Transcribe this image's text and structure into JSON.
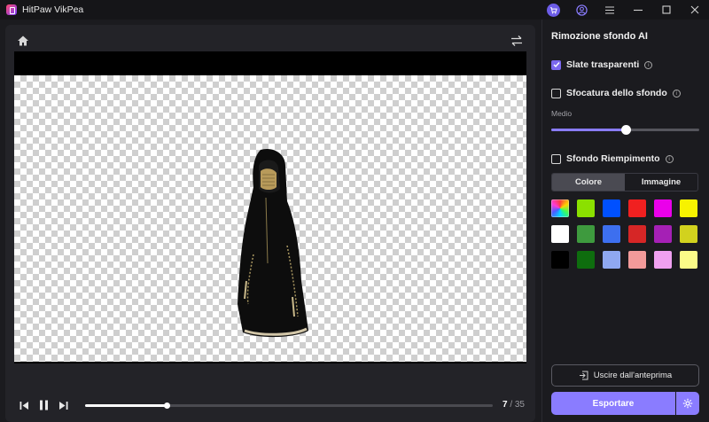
{
  "app": {
    "title": "HitPaw VikPea"
  },
  "player": {
    "current_frame": "7",
    "total_frames": "/ 35",
    "progress_fraction": 0.2
  },
  "panel": {
    "title": "Rimozione sfondo AI",
    "transparent_slate": {
      "label": "Slate trasparenti",
      "checked": true
    },
    "background_blur": {
      "label": "Sfocatura dello sfondo",
      "checked": false
    },
    "blur_level": {
      "label": "Medio",
      "value_fraction": 0.5
    },
    "background_fill": {
      "label": "Sfondo Riempimento",
      "checked": false
    },
    "tabs": [
      {
        "label": "Colore",
        "active": true
      },
      {
        "label": "Immagine",
        "active": false
      }
    ],
    "colors": [
      "gradient",
      "#8be000",
      "#0050ff",
      "#f02020",
      "#ea00ea",
      "#f7f200",
      "#ffffff",
      "#3e9a3e",
      "#3d6fef",
      "#d62626",
      "#a520b5",
      "#d2d21e",
      "#000000",
      "#0e6d0e",
      "#8fa8f0",
      "#f29a9a",
      "#f0a0f0",
      "#fbfb88"
    ],
    "exit_preview_label": "Uscire dall'anteprima",
    "export_label": "Esportare"
  },
  "icons": {
    "titlebar": [
      "cart-icon",
      "user-icon",
      "menu-icon",
      "minimize-icon",
      "maximize-icon",
      "close-icon"
    ],
    "preview": [
      "home-icon",
      "swap-icon"
    ],
    "player": [
      "previous-frame-icon",
      "pause-icon",
      "next-frame-icon"
    ],
    "panel": [
      "info-icon",
      "exit-icon",
      "settings-icon"
    ]
  }
}
